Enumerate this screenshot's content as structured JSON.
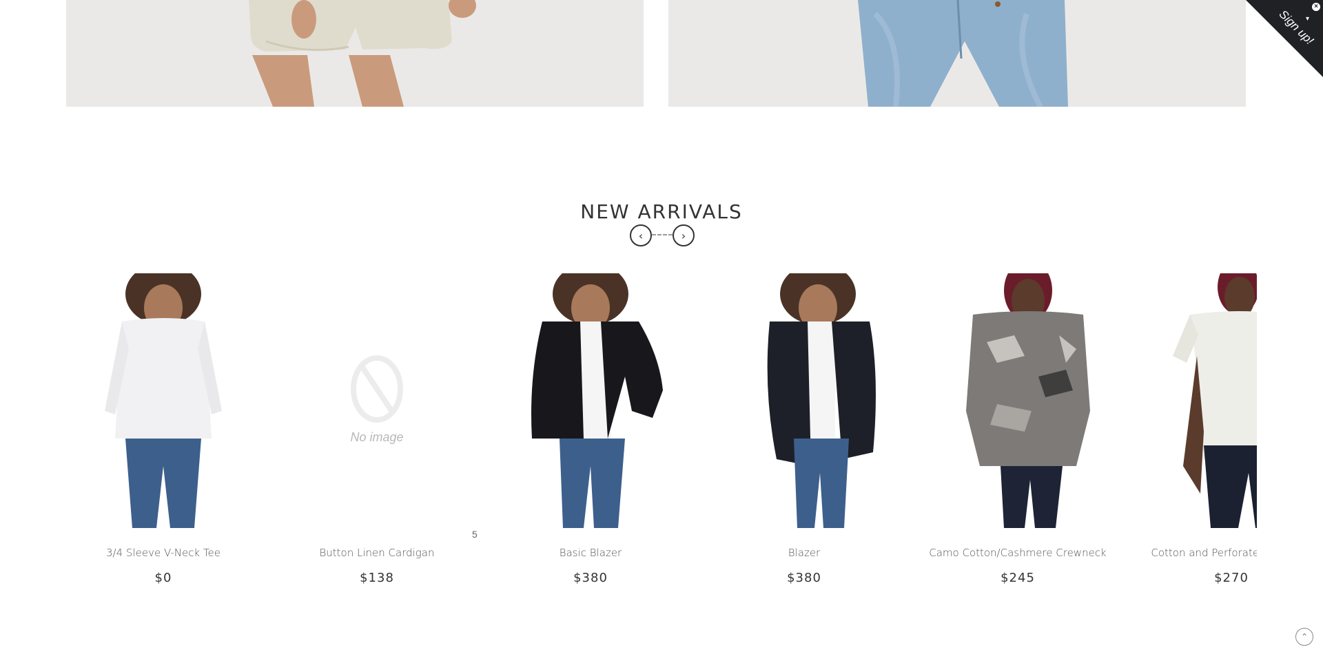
{
  "signup": {
    "label": "Sign up!",
    "close": "×",
    "arrow": "▾"
  },
  "section": {
    "title": "NEW ARRIVALS"
  },
  "carousel": {
    "prev": "‹",
    "next": "›"
  },
  "no_image_text": "No image",
  "stray_count": "5",
  "products": [
    {
      "name": "3/4 Sleeve V-Neck Tee",
      "price": "$0",
      "image": "white-v-neck-tee"
    },
    {
      "name": "Button Linen Cardigan",
      "price": "$138",
      "image": "no-image"
    },
    {
      "name": "Basic Blazer",
      "price": "$380",
      "image": "black-blazer"
    },
    {
      "name": "Blazer",
      "price": "$380",
      "image": "navy-blazer"
    },
    {
      "name": "Camo Cotton/Cashmere Crewneck",
      "price": "$245",
      "image": "camo-crewneck"
    },
    {
      "name": "Cotton and Perforated Leat Tee",
      "price": "$270",
      "image": "white-perforated-tee"
    }
  ],
  "colors": {
    "ribbon": "#1f2125",
    "text": "#333333",
    "bg": "#ffffff"
  }
}
